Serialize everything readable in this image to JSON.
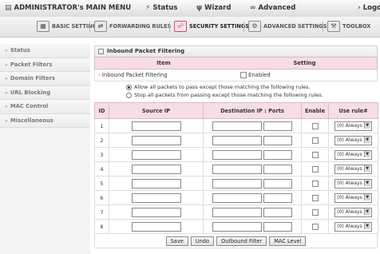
{
  "topbar": {
    "admin_menu": "ADMINISTRATOR's MAIN MENU",
    "status": "Status",
    "wizard": "Wizard",
    "advanced": "Advanced",
    "logout": "Logo"
  },
  "tabs": [
    {
      "label": "BASIC SETTINGS",
      "icon": "basic-settings-icon"
    },
    {
      "label": "FORWARDING RULES",
      "icon": "forwarding-rules-icon"
    },
    {
      "label": "SECURITY SETTINGS",
      "icon": "security-settings-icon",
      "active": true
    },
    {
      "label": "ADVANCED SETTINGS",
      "icon": "advanced-settings-icon"
    },
    {
      "label": "TOOLBOX",
      "icon": "toolbox-icon"
    }
  ],
  "sidebar": {
    "items": [
      {
        "label": "Status"
      },
      {
        "label": "Packet Filters"
      },
      {
        "label": "Domain Filters"
      },
      {
        "label": "URL Blocking"
      },
      {
        "label": "MAC Control"
      },
      {
        "label": "Miscellaneous"
      }
    ]
  },
  "panel": {
    "title": "Inbound Packet Filtering",
    "col_item": "Item",
    "col_setting": "Setting",
    "row_label": "Inbound Packet Filtering",
    "enabled_label": "Enabled",
    "enabled_checked": false,
    "radio_allow": "Allow all packets to pass except those matching the following rules.",
    "radio_stop": "Stop all packets from passing except those matching the following rules.",
    "radio_selected": "allow"
  },
  "rules_table": {
    "headers": {
      "id": "ID",
      "source": "Source IP",
      "dest": "Destination IP : Ports",
      "enable": "Enable",
      "userule": "Use rule#"
    },
    "rows": [
      {
        "id": "1",
        "use_rule": "(0) Always"
      },
      {
        "id": "2",
        "use_rule": "(0) Always"
      },
      {
        "id": "3",
        "use_rule": "(0) Always"
      },
      {
        "id": "4",
        "use_rule": "(0) Always"
      },
      {
        "id": "5",
        "use_rule": "(0) Always"
      },
      {
        "id": "6",
        "use_rule": "(0) Always"
      },
      {
        "id": "7",
        "use_rule": "(0) Always"
      },
      {
        "id": "8",
        "use_rule": "(0) Always"
      }
    ]
  },
  "buttons": {
    "save": "Save",
    "undo": "Undo",
    "outbound": "Outbound Filter",
    "mac": "MAC Level"
  },
  "colors": {
    "header_pink": "#f6dde6",
    "accent": "#c4527a"
  }
}
